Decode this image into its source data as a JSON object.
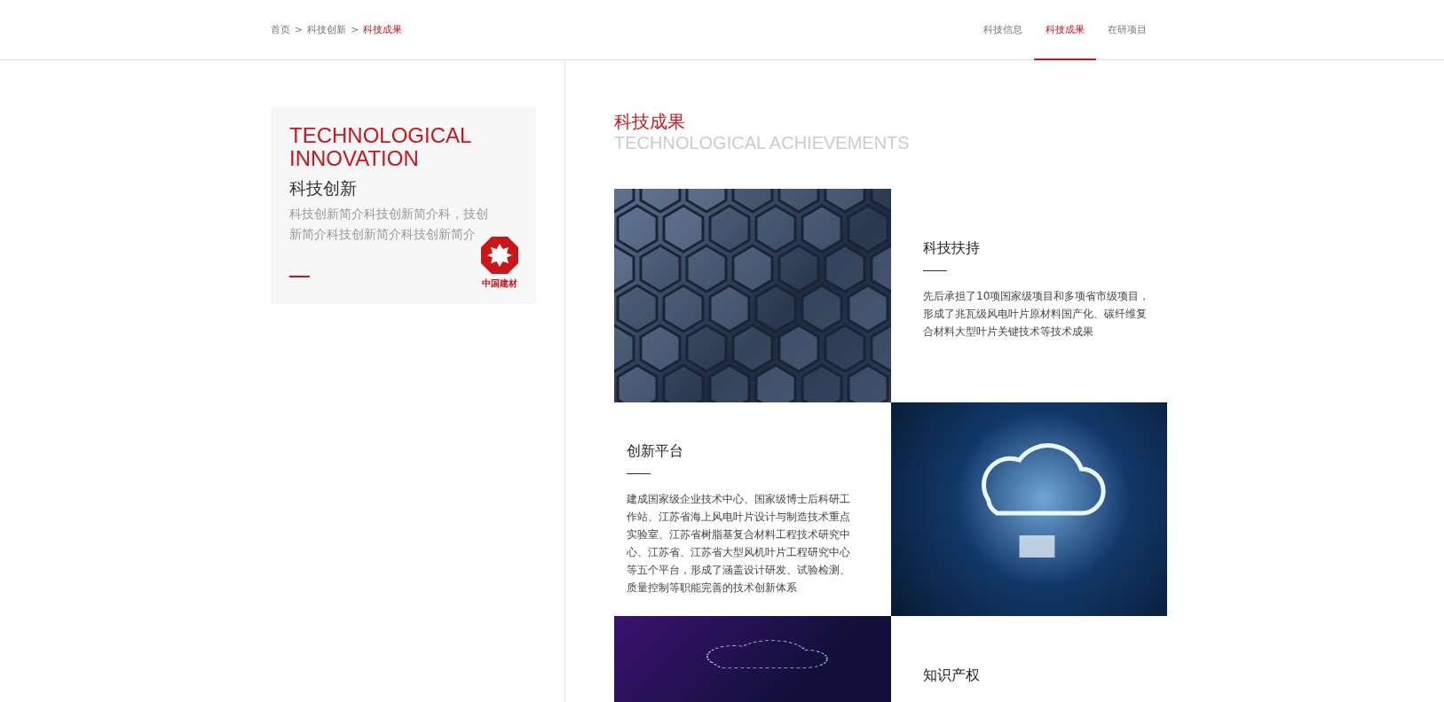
{
  "breadcrumb": {
    "separator": ">",
    "items": [
      {
        "label": "首页",
        "selected": false
      },
      {
        "label": "科技创新",
        "selected": false
      },
      {
        "label": "科技成果",
        "selected": true
      }
    ]
  },
  "nav": {
    "tabs": [
      {
        "label": "科技信息",
        "selected": false
      },
      {
        "label": "科技成果",
        "selected": true
      },
      {
        "label": "在研项目",
        "selected": false
      }
    ]
  },
  "sidebar_card": {
    "title_en": "TECHNOLOGICAL INNOVATION",
    "title": "科技创新",
    "description": "科技创新简介科技创新简介科，技创新简介科技创新简介科技创新简介",
    "logo_text": "中国建材"
  },
  "section": {
    "title": "科技成果",
    "subtitle": "TECHNOLOGICAL ACHIEVEMENTS"
  },
  "tiles": [
    {
      "kind": "hexagon-photo"
    },
    {
      "kind": "text",
      "title": "科技扶持",
      "description": "先后承担了10项国家级项目和多项省市级项目，形成了兆瓦级风电叶片原材料国产化、碳纤维复合材料大型叶片关键技术等技术成果"
    },
    {
      "kind": "text",
      "title": "创新平台",
      "description": "建成国家级企业技术中心、国家级博士后科研工作站、江苏省海上风电叶片设计与制造技术重点实验室、江苏省树脂基复合材料工程技术研究中心、江苏省、江苏省大型风机叶片工程研究中心等五个平台，形成了涵盖设计研发、试验检测、质量控制等职能完善的技术创新体系"
    },
    {
      "kind": "chip-photo"
    },
    {
      "kind": "network-photo"
    },
    {
      "kind": "text",
      "title": "知识产权"
    }
  ]
}
